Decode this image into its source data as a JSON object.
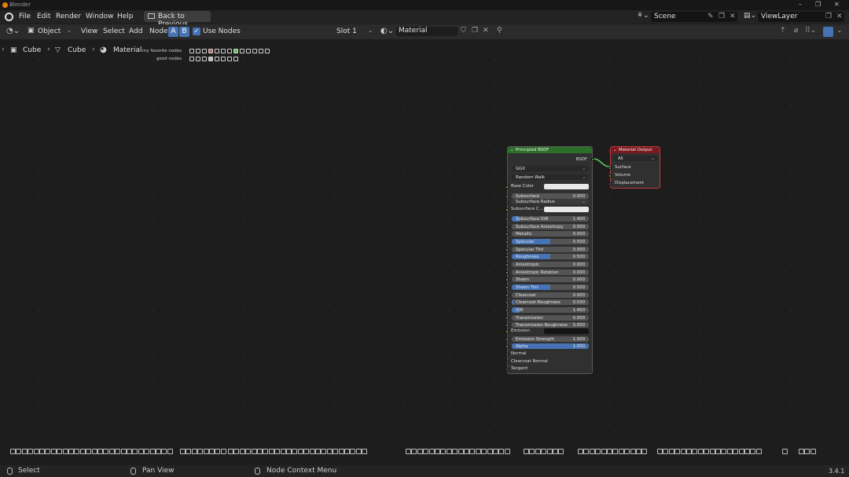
{
  "window": {
    "title": "Blender",
    "controls": [
      "–",
      "❐",
      "✕"
    ]
  },
  "menu": {
    "items": [
      "File",
      "Edit",
      "Render",
      "Window",
      "Help"
    ],
    "back_button": "Back to Previous",
    "scene": "Scene",
    "view_layer": "ViewLayer"
  },
  "header": {
    "mode": "Object",
    "menus": [
      "View",
      "Select",
      "Add",
      "Node"
    ],
    "toggle_a": "A",
    "toggle_b": "B",
    "use_nodes_checked": true,
    "use_nodes_label": "Use Nodes",
    "slot": "Slot 1",
    "material": "Material"
  },
  "breadcrumb": {
    "items": [
      "Cube",
      "Cube",
      "Material"
    ]
  },
  "favorites": {
    "row1_label": "my favorite nodes",
    "row2_label": "good nodes"
  },
  "principled_node": {
    "title": "Principled BSDF",
    "output_label": "BSDF",
    "distribution": "GGX",
    "subsurface_method": "Random Walk",
    "base_color_label": "Base Color",
    "subsurface_color_label": "Subsurface C...",
    "subsurface_radius_label": "Subsurface Radius",
    "emission_label": "Emission",
    "rows": [
      {
        "label": "Subsurface",
        "value": "0.000",
        "fill": 0.0
      },
      {
        "label": "Subsurface IOR",
        "value": "1.400",
        "fill": 0.1
      },
      {
        "label": "Subsurface Anisotropy",
        "value": "0.000",
        "fill": 0.0
      },
      {
        "label": "Metallic",
        "value": "0.000",
        "fill": 0.0
      },
      {
        "label": "Specular",
        "value": "0.500",
        "fill": 0.5
      },
      {
        "label": "Specular Tint",
        "value": "0.000",
        "fill": 0.0
      },
      {
        "label": "Roughness",
        "value": "0.500",
        "fill": 0.5
      },
      {
        "label": "Anisotropic",
        "value": "0.000",
        "fill": 0.0
      },
      {
        "label": "Anisotropic Rotation",
        "value": "0.000",
        "fill": 0.0
      },
      {
        "label": "Sheen",
        "value": "0.000",
        "fill": 0.0
      },
      {
        "label": "Sheen Tint",
        "value": "0.500",
        "fill": 0.5
      },
      {
        "label": "Clearcoat",
        "value": "0.000",
        "fill": 0.0
      },
      {
        "label": "Clearcoat Roughness",
        "value": "0.030",
        "fill": 0.03
      },
      {
        "label": "IOR",
        "value": "1.450",
        "fill": 0.1
      },
      {
        "label": "Transmission",
        "value": "0.000",
        "fill": 0.0
      },
      {
        "label": "Transmission Roughness",
        "value": "0.000",
        "fill": 0.0
      }
    ],
    "emission_strength": {
      "label": "Emission Strength",
      "value": "1.000",
      "fill": 0.0
    },
    "alpha": {
      "label": "Alpha",
      "value": "1.000",
      "fill": 1.0
    },
    "vector_inputs": [
      "Normal",
      "Clearcoat Normal",
      "Tangent"
    ]
  },
  "output_node": {
    "title": "Material Output",
    "target": "All",
    "inputs": [
      "Surface",
      "Volume",
      "Displacement"
    ]
  },
  "status": {
    "select": "Select",
    "pan": "Pan View",
    "context": "Node Context Menu",
    "version": "3.4.1"
  },
  "colors": {
    "accent": "#4772b3",
    "shader_header": "#2b6f28",
    "output_header": "#7a1a1e",
    "socket_shader": "#5fc35f",
    "socket_color": "#c7c729",
    "socket_float": "#a1a1a1",
    "socket_vector": "#6363c7"
  }
}
